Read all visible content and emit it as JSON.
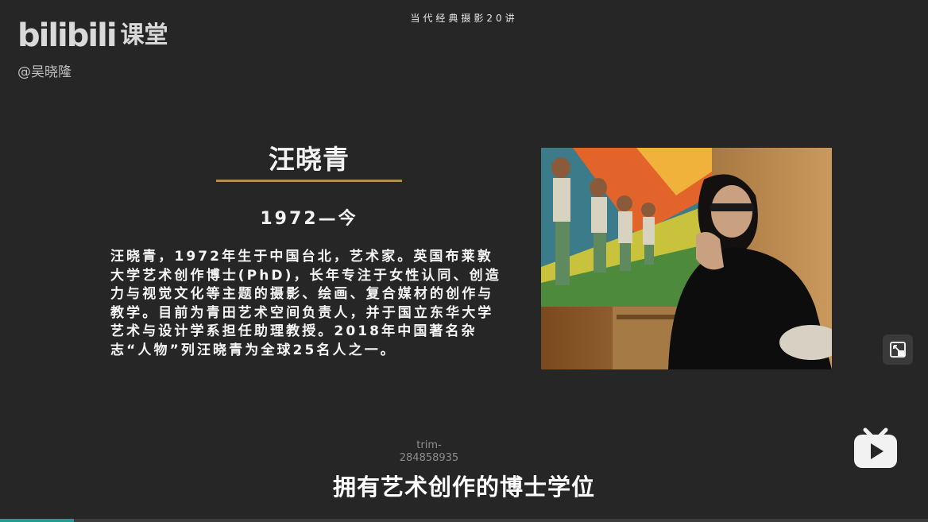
{
  "header": {
    "course_title": "当代经典摄影20讲",
    "logo_text": "bilibili",
    "logo_sub": "课堂",
    "uploader": "@吴晓隆"
  },
  "slide": {
    "name": "汪晓青",
    "years": "1972—今",
    "bio": "汪晓青，1972年生于中国台北，艺术家。英国布莱敦大学艺术创作博士(PhD)，长年专注于女性认同、创造力与视觉文化等主题的摄影、绘画、复合媒材的创作与教学。目前为青田艺术空间负责人，并于国立东华大学艺术与设计学系担任助理教授。2018年中国著名杂志“人物”列汪晓青为全球25名人之一。"
  },
  "player": {
    "watermark_line1": "trim-",
    "watermark_line2": "284858935",
    "subtitle": "拥有艺术创作的博士学位",
    "progress_fraction": 0.08,
    "accent_color": "#1d9e8f"
  },
  "icons": {
    "expand": "expand-screen-icon",
    "tv": "bilibili-tv-icon"
  }
}
